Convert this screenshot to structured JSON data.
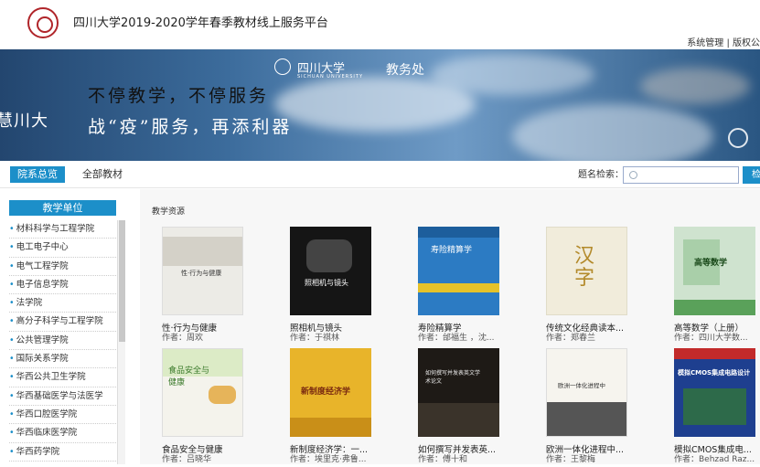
{
  "header": {
    "site_title": "四川大学2019-2020学年春季教材线上服务平台",
    "links": "系统管理 | 版权公"
  },
  "banner": {
    "left_text": "慧川大",
    "university": "四川大学",
    "university_en": "SICHUAN UNIVERSITY",
    "dept": "教务处",
    "line1": "不停教学，不停服务",
    "line2": "战“疫”服务，再添利器"
  },
  "tabs": {
    "active": "院系总览",
    "all": "全部教材",
    "search_label": "题名检索：",
    "search_btn": "检"
  },
  "sidebar": {
    "title": "教学单位",
    "items": [
      "材料科学与工程学院",
      "电工电子中心",
      "电气工程学院",
      "电子信息学院",
      "法学院",
      "高分子科学与工程学院",
      "公共管理学院",
      "国际关系学院",
      "华西公共卫生学院",
      "华西基础医学与法医学",
      "华西口腔医学院",
      "华西临床医学院",
      "华西药学院"
    ]
  },
  "content": {
    "title": "教学资源",
    "books": [
      {
        "title": "性·行为与健康",
        "author": "作者：周欢",
        "cover_text": "性·行为与健康"
      },
      {
        "title": "照相机与镜头",
        "author": "作者：于祺林",
        "cover_text": "照相机与镜头"
      },
      {
        "title": "寿险精算学",
        "author": "作者：邰福生 ，沈...",
        "cover_text": "寿险精算学"
      },
      {
        "title": "传统文化经典读本...",
        "author": "作者：郑春兰",
        "cover_text": "汉字"
      },
      {
        "title": "高等数学（上册）",
        "author": "作者：四川大学数...",
        "cover_text": "高等数学"
      },
      {
        "title": "食品安全与健康",
        "author": "作者：吕晓华",
        "cover_text": "食品安全与健康"
      },
      {
        "title": "新制度经济学：一...",
        "author": "作者：埃里克·弗鲁...",
        "cover_text": "新制度经济学"
      },
      {
        "title": "如何撰写并发表英...",
        "author": "作者：傅十和",
        "cover_text": "如何撰写并发表英文学术论文"
      },
      {
        "title": "欧洲一体化进程中...",
        "author": "作者：王黎梅",
        "cover_text": "欧洲一体化进程中"
      },
      {
        "title": "模拟CMOS集成电...",
        "author": "作者：Behzad Raz...",
        "cover_text": "模拟CMOS集成电路设计"
      }
    ]
  },
  "colors": {
    "accent": "#1c8fc9"
  }
}
